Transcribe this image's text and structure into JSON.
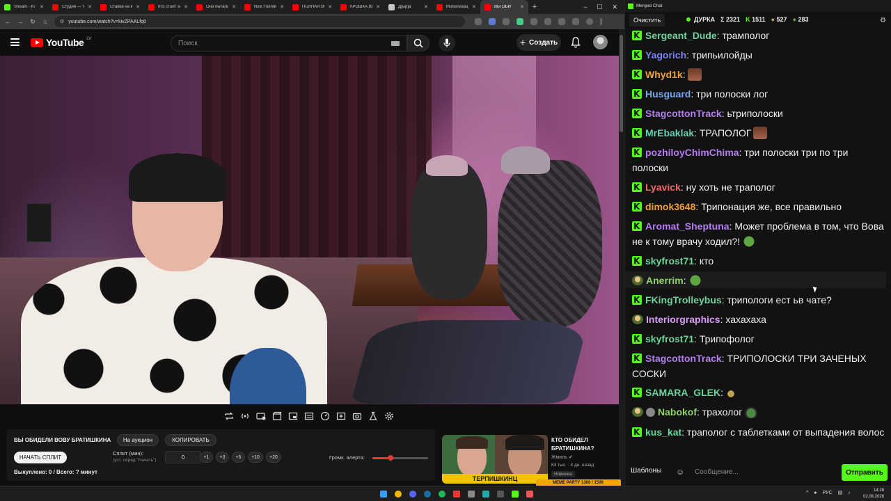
{
  "browser": {
    "tabs": [
      {
        "label": "Stream - Ki",
        "color": "#53fc18"
      },
      {
        "label": "Студия — YI",
        "color": "#ff0000"
      },
      {
        "label": "Ставка на в",
        "color": "#ff0000"
      },
      {
        "label": "Кто стоит за",
        "color": "#ff0000"
      },
      {
        "label": "Они пытали",
        "color": "#ff0000"
      },
      {
        "label": "Nick Fuente",
        "color": "#ff0000"
      },
      {
        "label": "ПОЛНАЯ ВС",
        "color": "#ff0000"
      },
      {
        "label": "КРОШКА ВЕ",
        "color": "#ff0000"
      },
      {
        "label": "Д[ыр]а",
        "color": "#c8c8c8"
      },
      {
        "label": "Мобилизац",
        "color": "#ff0000"
      },
      {
        "label": "ВЫ ОБИ",
        "color": "#ff0000",
        "active": true
      }
    ],
    "url": "youtube.com/watch?v=kivZPAALfq0",
    "window_controls": [
      "–",
      "☐",
      "✕"
    ]
  },
  "youtube": {
    "logo_text": "YouTube",
    "logo_country": "LV",
    "search_placeholder": "Поиск",
    "create_label": "Создать"
  },
  "auction": {
    "title": "ВЫ ОБИДЕЛИ ВОВУ БРАТИШКИНА",
    "on_auction_label": "На аукцион",
    "copy_label": "КОПИРОВАТЬ",
    "start_split_label": "НАЧАТЬ СПЛИТ",
    "split_label": "Сплит (мин):",
    "split_hint": "(уст. перед \"Начать\")",
    "split_value": "0",
    "increments": [
      "+1",
      "+3",
      "+5",
      "+10",
      "+20"
    ],
    "alert_volume_label": "Громк. алерта:",
    "alert_volume_fraction": 0.32,
    "bought_text": "Выкуплено: 0 / Всего: ? минут"
  },
  "recommendation": {
    "title": "КТО ОБИДЕЛ БРАТИШКИНА?",
    "channel": "Жмиль",
    "meta": "63 тыс. · 4 дн. назад",
    "badge": "Новинка",
    "banner_text": "ТЕРПИШКИНЦ",
    "meme_text": "MEME PARTY",
    "meme_count": "1300 / 1500"
  },
  "chat": {
    "window_title": "Merged Chat",
    "clear_label": "Очистить",
    "channel": "ДУРКА",
    "stat_total": "Σ 2321",
    "stat_kick": "1511",
    "stat_a": "527",
    "stat_b": "283",
    "templates_label": "Шаблоны",
    "input_placeholder": "Сообщение...",
    "send_label": "Отправить",
    "messages": [
      {
        "user": "Sergeant_Dude",
        "color": "#6fd39c",
        "text": ": трамполог",
        "badge": "kick"
      },
      {
        "user": "Yagorich",
        "color": "#7b83f5",
        "text": ": трипьилойды",
        "badge": "kick"
      },
      {
        "user": "Whyd1k",
        "color": "#f0a13a",
        "text": ":",
        "badge": "kick",
        "emote": "face"
      },
      {
        "user": "Husguard",
        "color": "#77a7f2",
        "text": ": три полоски лог",
        "badge": "kick"
      },
      {
        "user": "StagcottonTrack",
        "color": "#b57cf0",
        "text": ": ьтриполоски",
        "badge": "kick"
      },
      {
        "user": "MrEbaklak",
        "color": "#66d0b4",
        "text": ": ТРАПОЛОГ",
        "badge": "kick",
        "emote": "face"
      },
      {
        "user": "pozhiloyChimChima",
        "color": "#b57cf0",
        "text": ": три полоски три по три полоски",
        "badge": "kick"
      },
      {
        "user": "Lyavick",
        "color": "#f06a6a",
        "text": ": ну хоть не траполог",
        "badge": "kick"
      },
      {
        "user": "dimok3648",
        "color": "#f0a13a",
        "text": ": Трипонация же, все правильно",
        "badge": "kick"
      },
      {
        "user": "Aromat_Sheptuna",
        "color": "#b57cf0",
        "text": ": Может проблема в том, что Вова не к тому врачу ходил?!",
        "badge": "kick",
        "emote": "pepe"
      },
      {
        "user": "skyfrost71",
        "color": "#6fd39c",
        "text": ": кто",
        "badge": "kick"
      },
      {
        "user": "Anerrim",
        "color": "#8fd36a",
        "text": ":",
        "badge": "sub",
        "emote": "pepe"
      },
      {
        "user": "FKingTrolleybus",
        "color": "#6fd39c",
        "text": ": трипологи ест ьв чате?",
        "badge": "kick"
      },
      {
        "user": "Interiorgraphics",
        "color": "#d79cf5",
        "text": ": хахахаха",
        "badge": "sub"
      },
      {
        "user": "skyfrost71",
        "color": "#6fd39c",
        "text": ": Трипофолог",
        "badge": "kick"
      },
      {
        "user": "StagcottonTrack",
        "color": "#b57cf0",
        "text": ": ТРИПОЛОСКИ ТРИ ЗАЧЕНЫХ СОСКИ",
        "badge": "kick"
      },
      {
        "user": "SAMARA_GLEK",
        "color": "#6fd39c",
        "text": ":",
        "badge": "kick",
        "emote": "small"
      },
      {
        "user": "Nabokof",
        "color": "#8fd36a",
        "text": ": трахолог",
        "badge": "sub2",
        "emote": "hat"
      },
      {
        "user": "kus_kat",
        "color": "#6fd39c",
        "text": ": траполог с таблетками от выпадения волос",
        "badge": "kick"
      }
    ]
  },
  "taskbar": {
    "lang": "РУС",
    "time": "14:28",
    "date": "02.08.2026"
  }
}
